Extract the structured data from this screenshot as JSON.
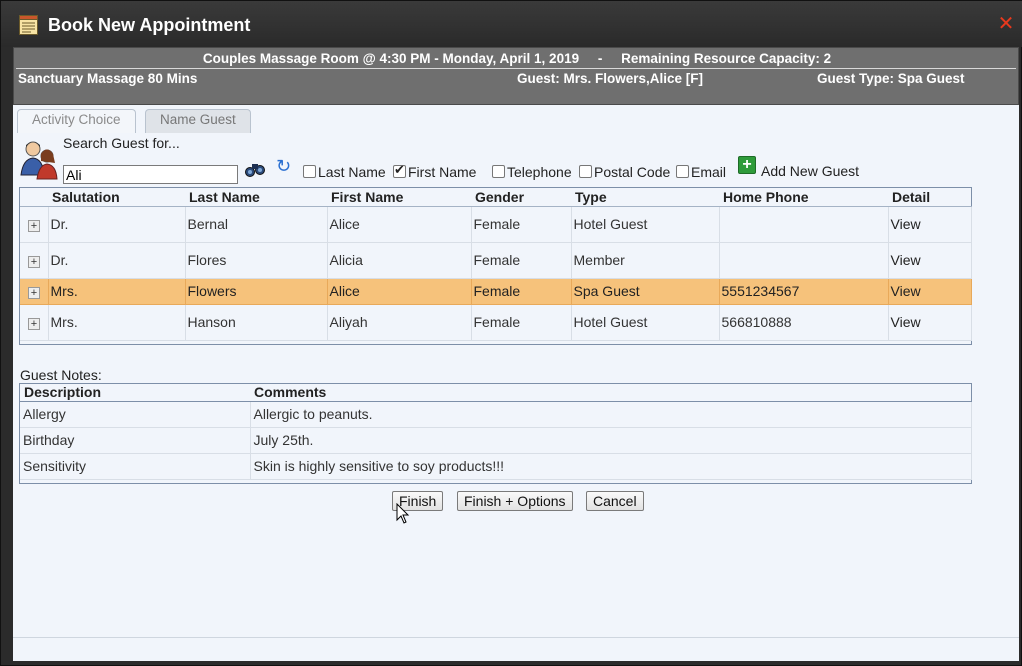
{
  "window": {
    "title": "Book New Appointment",
    "title_icon": "calendar-icon",
    "close_icon": "close-icon",
    "close_color": "#e8391d"
  },
  "header": {
    "line1": "Couples Massage Room @ 4:30 PM - Monday, April 1, 2019     -     Remaining Resource Capacity: 2",
    "service": "Sanctuary Massage 80 Mins",
    "guest": "Guest: Mrs. Flowers,Alice [F]",
    "guest_type": "Guest Type: Spa Guest"
  },
  "tabs": [
    {
      "label": "Activity Choice",
      "active": false
    },
    {
      "label": "Name Guest",
      "active": true
    }
  ],
  "search": {
    "label": "Search Guest for...",
    "value": "Ali",
    "filters": [
      {
        "label": "Last Name",
        "checked": false
      },
      {
        "label": "First Name",
        "checked": true
      },
      {
        "label": "Telephone",
        "checked": false
      },
      {
        "label": "Postal Code",
        "checked": false
      },
      {
        "label": "Email",
        "checked": false
      }
    ],
    "add_new_label": "Add New Guest"
  },
  "guest_table": {
    "columns": [
      "Salutation",
      "Last Name",
      "First Name",
      "Gender",
      "Type",
      "Home Phone",
      "Detail"
    ],
    "rows": [
      {
        "salutation": "Dr.",
        "last": "Bernal",
        "first": "Alice",
        "gender": "Female",
        "type": "Hotel Guest",
        "phone": "",
        "detail": "View",
        "selected": false
      },
      {
        "salutation": "Dr.",
        "last": "Flores",
        "first": "Alicia",
        "gender": "Female",
        "type": "Member",
        "phone": "",
        "detail": "View",
        "selected": false
      },
      {
        "salutation": "Mrs.",
        "last": "Flowers",
        "first": "Alice",
        "gender": "Female",
        "type": "Spa Guest",
        "phone": "5551234567",
        "detail": "View",
        "selected": true
      },
      {
        "salutation": "Mrs.",
        "last": "Hanson",
        "first": "Aliyah",
        "gender": "Female",
        "type": "Hotel Guest",
        "phone": "566810888",
        "detail": "View",
        "selected": false
      }
    ],
    "selected_color": "#f6c27b"
  },
  "notes": {
    "label": "Guest Notes:",
    "columns": [
      "Description",
      "Comments"
    ],
    "rows": [
      {
        "description": "Allergy",
        "comment": "Allergic to peanuts."
      },
      {
        "description": "Birthday",
        "comment": "July 25th."
      },
      {
        "description": "Sensitivity",
        "comment": "Skin is highly sensitive to soy products!!!"
      }
    ]
  },
  "buttons": {
    "finish": "Finish",
    "finish_options": "Finish + Options",
    "cancel": "Cancel"
  }
}
